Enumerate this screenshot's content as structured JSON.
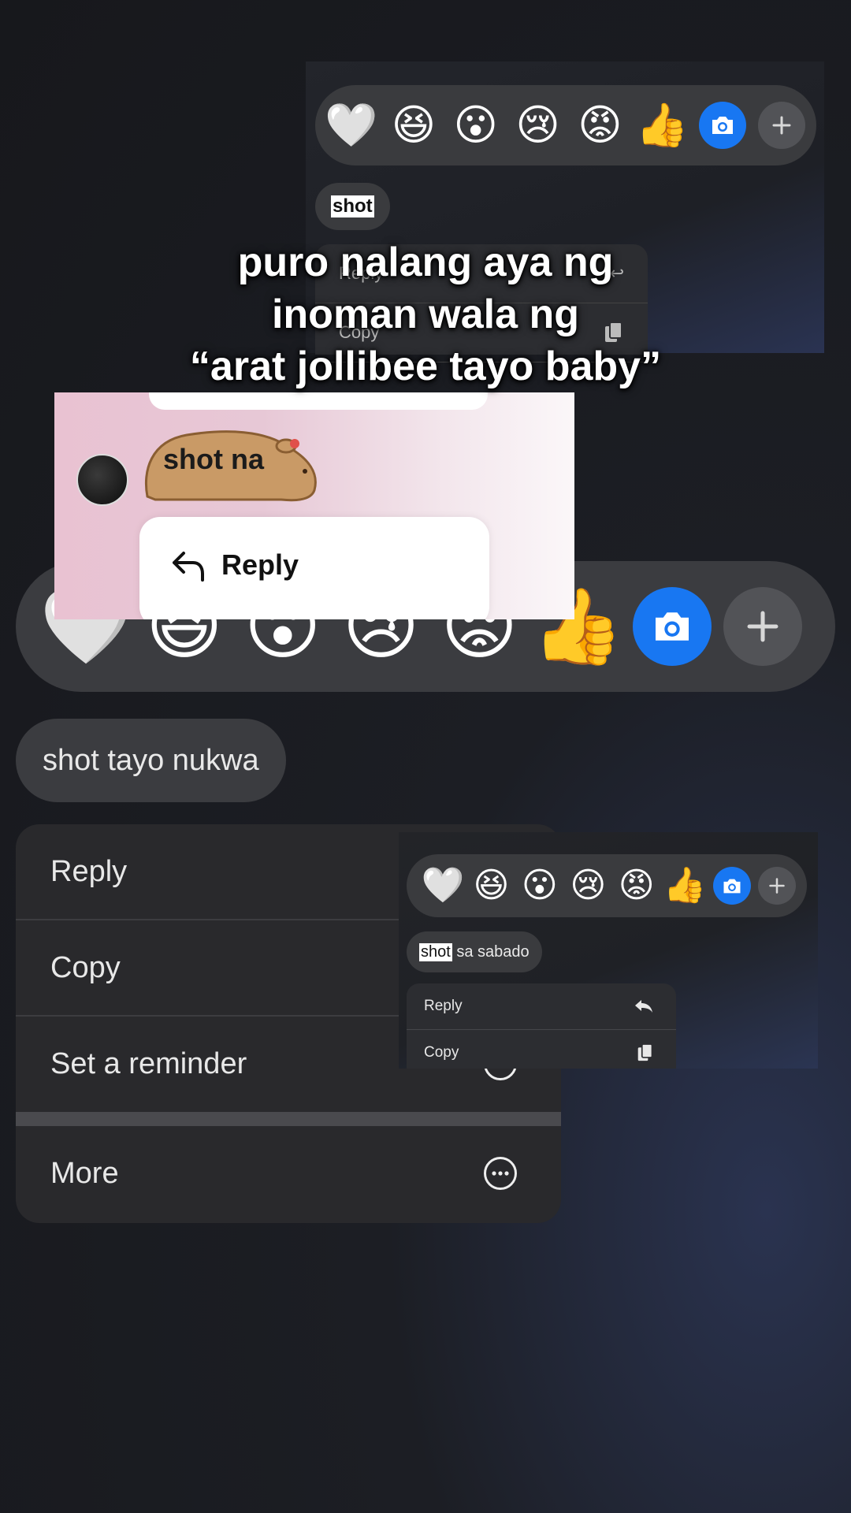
{
  "reactions": [
    "🤍",
    "😆",
    "😮",
    "😢",
    "😡",
    "👍"
  ],
  "top_panel": {
    "bubble": {
      "highlight": "shot",
      "rest": ""
    },
    "menu": [
      {
        "label": "Reply",
        "icon": "reply-arrow-icon"
      },
      {
        "label": "Copy",
        "icon": "copy-icon"
      }
    ]
  },
  "caption": {
    "line1": "puro nalang aya ng",
    "line2": "inoman wala ng",
    "line3": "“arat jollibee tayo baby”"
  },
  "light_card": {
    "sticker_text": "shot na",
    "reply_label": "Reply"
  },
  "middle_bubble": "shot tayo nukwa",
  "big_menu": {
    "reply": "Reply",
    "copy": "Copy",
    "reminder": "Set a reminder",
    "more": "More"
  },
  "small_panel": {
    "bubble": {
      "highlight": "shot",
      "rest": " sa sabado"
    },
    "menu": [
      {
        "label": "Reply",
        "icon": "reply-arrow-icon"
      },
      {
        "label": "Copy",
        "icon": "copy-icon"
      }
    ]
  },
  "colors": {
    "accent_blue": "#1877f2",
    "bubble_bg": "#3b3c40",
    "menu_bg": "#29292c"
  }
}
